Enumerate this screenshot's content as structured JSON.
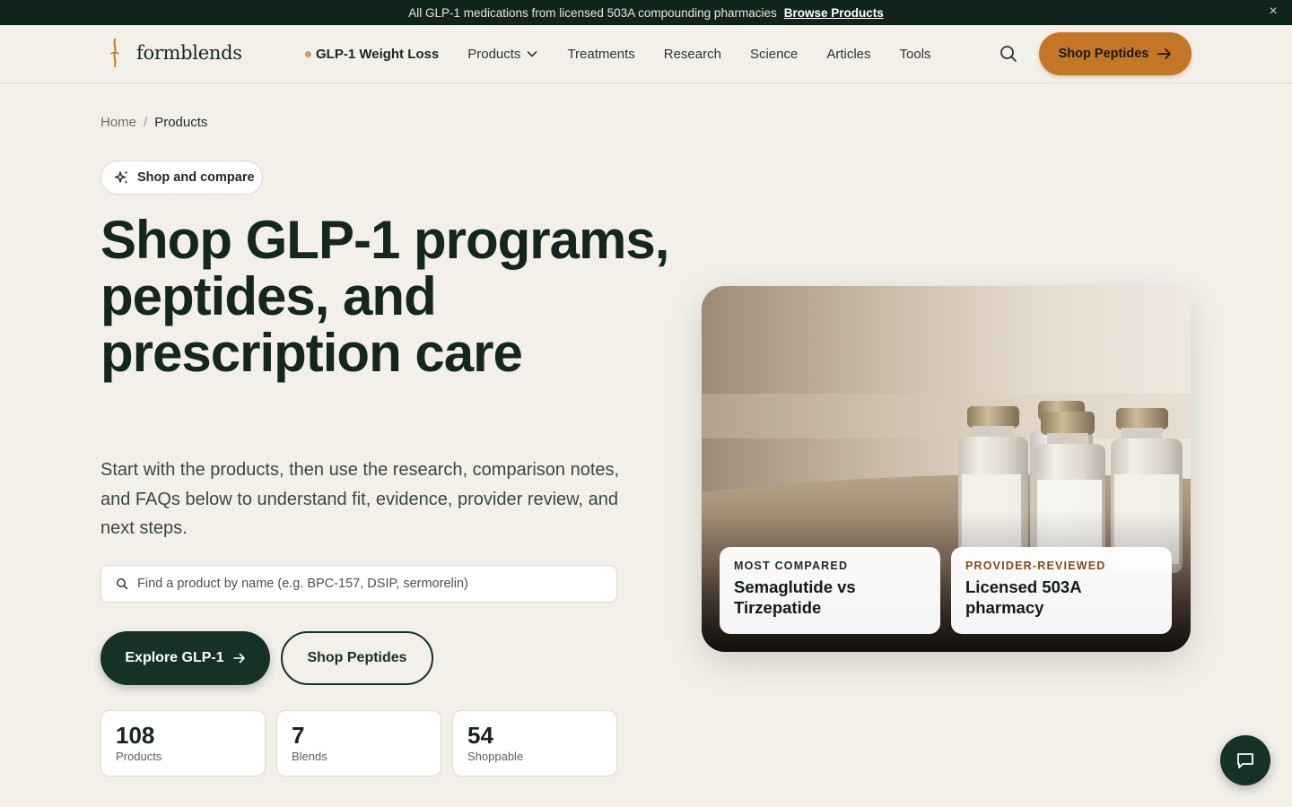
{
  "announcement": {
    "text": "All GLP-1 medications from licensed 503A compounding pharmacies",
    "link_label": "Browse Products",
    "close_label": "×"
  },
  "header": {
    "logo_text": "formblends",
    "nav": [
      {
        "label": "GLP-1 Weight Loss",
        "icon": "status-dot"
      },
      {
        "label": "Products",
        "icon": "chevron-down-icon"
      },
      {
        "label": "Treatments"
      },
      {
        "label": "Research"
      },
      {
        "label": "Science"
      },
      {
        "label": "Articles"
      },
      {
        "label": "Tools"
      }
    ],
    "search_icon": "search-icon",
    "shop_button": "Shop Peptides"
  },
  "breadcrumb": {
    "home": "Home",
    "separator": "/",
    "current": "Products"
  },
  "hero": {
    "pill_label": "Shop and compare",
    "headline": "Shop GLP-1 programs, peptides, and prescription care",
    "subtitle": "Start with the products, then use the research, comparison notes, and FAQs below to understand fit, evidence, provider review, and next steps.",
    "search_placeholder": "Find a product by name (e.g. BPC-157, DSIP, sermorelin)",
    "cta_primary": "Explore GLP-1",
    "cta_secondary": "Shop Peptides"
  },
  "stats": [
    {
      "value": "108",
      "label": "Products"
    },
    {
      "value": "7",
      "label": "Blends"
    },
    {
      "value": "54",
      "label": "Shoppable"
    }
  ],
  "image_cards": [
    {
      "kicker": "MOST COMPARED",
      "title": "Semaglutide vs Tirzepatide",
      "kicker_color": "#1d2a24"
    },
    {
      "kicker": "PROVIDER-REVIEWED",
      "title": "Licensed 503A pharmacy",
      "kicker_color": "#8a4a12"
    }
  ],
  "colors": {
    "background": "#f3f0ea",
    "brand_dark": "#163226",
    "accent": "#c47627",
    "announcement_bg": "#11241c"
  }
}
